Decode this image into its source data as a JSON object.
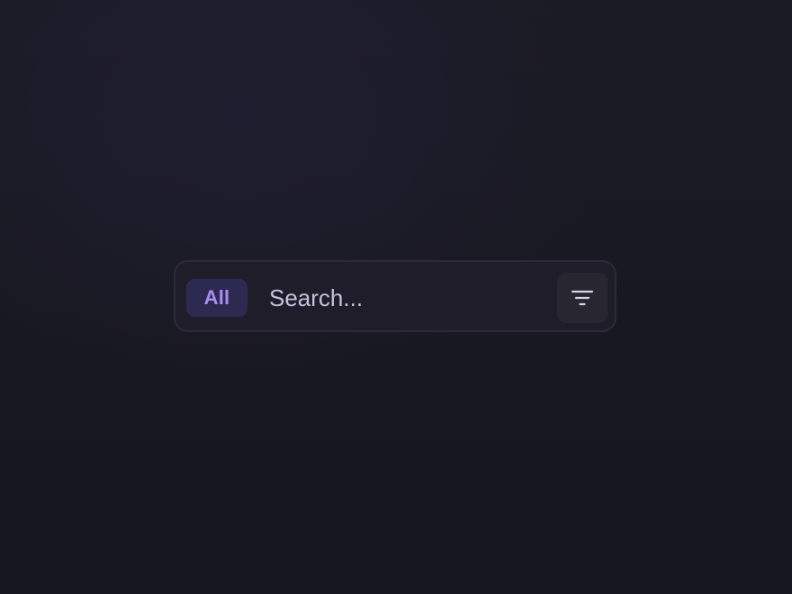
{
  "search_bar": {
    "scope_label": "All",
    "input_value": "",
    "placeholder": "Search...",
    "filter_icon": "filter-icon"
  },
  "colors": {
    "accent": "#a98ff2",
    "chip_background": "#2d2a52",
    "bar_background": "#1e1d29",
    "page_background": "#18171f"
  }
}
